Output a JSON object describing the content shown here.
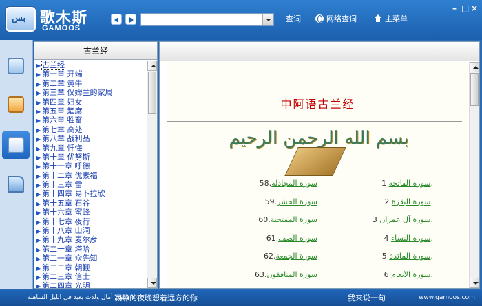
{
  "app": {
    "title": "歌木斯",
    "subtitle": "GAMOOS",
    "badge": "بس"
  },
  "toolbar": {
    "search_value": "",
    "query_label": "查词",
    "online_query_label": "网络查词",
    "main_menu_label": "主菜单",
    "minimize": "–",
    "restore": "□",
    "close": "×"
  },
  "sidebar": {
    "items": [
      {
        "icon": "search-doc-icon",
        "selected": false
      },
      {
        "icon": "chat-bubble-icon",
        "selected": false
      },
      {
        "icon": "book-icon",
        "selected": true
      },
      {
        "icon": "folder-icon",
        "selected": false
      }
    ]
  },
  "chapter_list": {
    "header": "古兰经",
    "items": [
      "古兰经",
      "第一章  开端",
      "第二章  黄牛",
      "第三章  仪姆兰的家属",
      "第四章  妇女",
      "第五章  筵席",
      "第六章  牲畜",
      "第七章  高处",
      "第八章  战利品",
      "第九章  忏悔",
      "第十章  优努斯",
      "第十一章  呼德",
      "第十二章  优素福",
      "第十三章  雷",
      "第十四章  易卜拉欣",
      "第十五章  石谷",
      "第十六章  蜜蜂",
      "第十七章  夜行",
      "第十八章  山洞",
      "第十九章  麦尔彦",
      "第二十章  塔哈",
      "第二一章  众先知",
      "第二二章  朝觐",
      "第二三章  信士",
      "第二四章  光明"
    ]
  },
  "document": {
    "title": "中阿语古兰经",
    "basmala": "بسم الله الرحمن الرحيم",
    "left_column": [
      {
        "num": "1.",
        "name": "سورة الفاتحة"
      },
      {
        "num": "2.",
        "name": "سورة البقرة"
      },
      {
        "num": "3.",
        "name": "سورة آل عمران"
      },
      {
        "num": "4.",
        "name": "سورة النساء"
      },
      {
        "num": "5.",
        "name": "سورة المائدة"
      },
      {
        "num": "6.",
        "name": "سورة الأنعام"
      }
    ],
    "right_column": [
      {
        "num": ".58",
        "name": "سورة المجادلة"
      },
      {
        "num": ".59",
        "name": "سورة الحشر"
      },
      {
        "num": ".60",
        "name": "سورة الممتحنة"
      },
      {
        "num": ".61",
        "name": "سورة الصف"
      },
      {
        "num": ".62",
        "name": "سورة الجمعة"
      },
      {
        "num": ".63",
        "name": "سورة المنافقون"
      }
    ]
  },
  "statusbar": {
    "arabic_quote": "لا منتهى أمال ولدت بعيد في الليل الساهلة",
    "quote": "寂静的夜晚想着远方的你",
    "feedback": "我来说一句",
    "website": "www.gamoos.com"
  }
}
